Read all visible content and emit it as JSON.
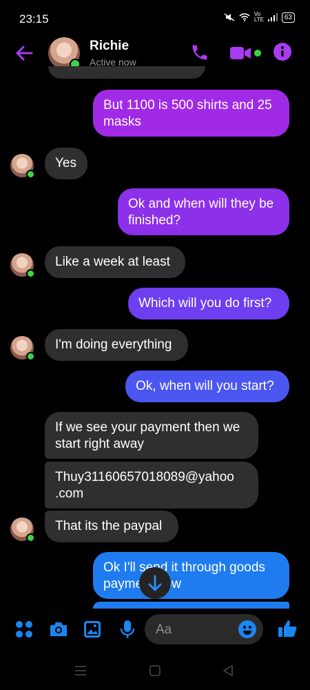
{
  "status": {
    "time": "23:15",
    "battery": "63",
    "network": "Vo LTE"
  },
  "header": {
    "name": "Richie",
    "status": "Active now",
    "accent": "#a93bf0"
  },
  "messages": [
    {
      "side": "out",
      "text": "But 1100 is 500 shirts and 25 masks",
      "color": "#a12ae6"
    },
    {
      "side": "in",
      "text": "Yes"
    },
    {
      "side": "out",
      "text": "Ok and when will they be finished?",
      "color": "#8c30ea"
    },
    {
      "side": "in",
      "text": "Like a week at least"
    },
    {
      "side": "out",
      "text": "Which will you do first?",
      "color": "#6d3ff0"
    },
    {
      "side": "in",
      "text": "I'm doing everything"
    },
    {
      "side": "out",
      "text": "Ok, when will you start?",
      "color": "#4b56f0"
    },
    {
      "side": "in",
      "text": "If we see your payment then we start right away"
    },
    {
      "side": "in",
      "text": "Thuy31160657018089@yahoo .com"
    },
    {
      "side": "in",
      "text": "That its the paypal"
    },
    {
      "side": "out",
      "text": "Ok I'll send it through goods payment now",
      "color": "#1e7cf0"
    }
  ],
  "composer": {
    "placeholder": "Aa",
    "accent": "#1a86f0"
  },
  "icons": {
    "header": [
      "back-arrow-icon",
      "phone-icon",
      "video-call-icon",
      "info-icon"
    ],
    "composer": [
      "apps-icon",
      "camera-icon",
      "gallery-icon",
      "microphone-icon",
      "emoji-icon",
      "thumbs-up-icon"
    ],
    "nav": [
      "menu-icon",
      "home-icon",
      "back-icon"
    ]
  }
}
